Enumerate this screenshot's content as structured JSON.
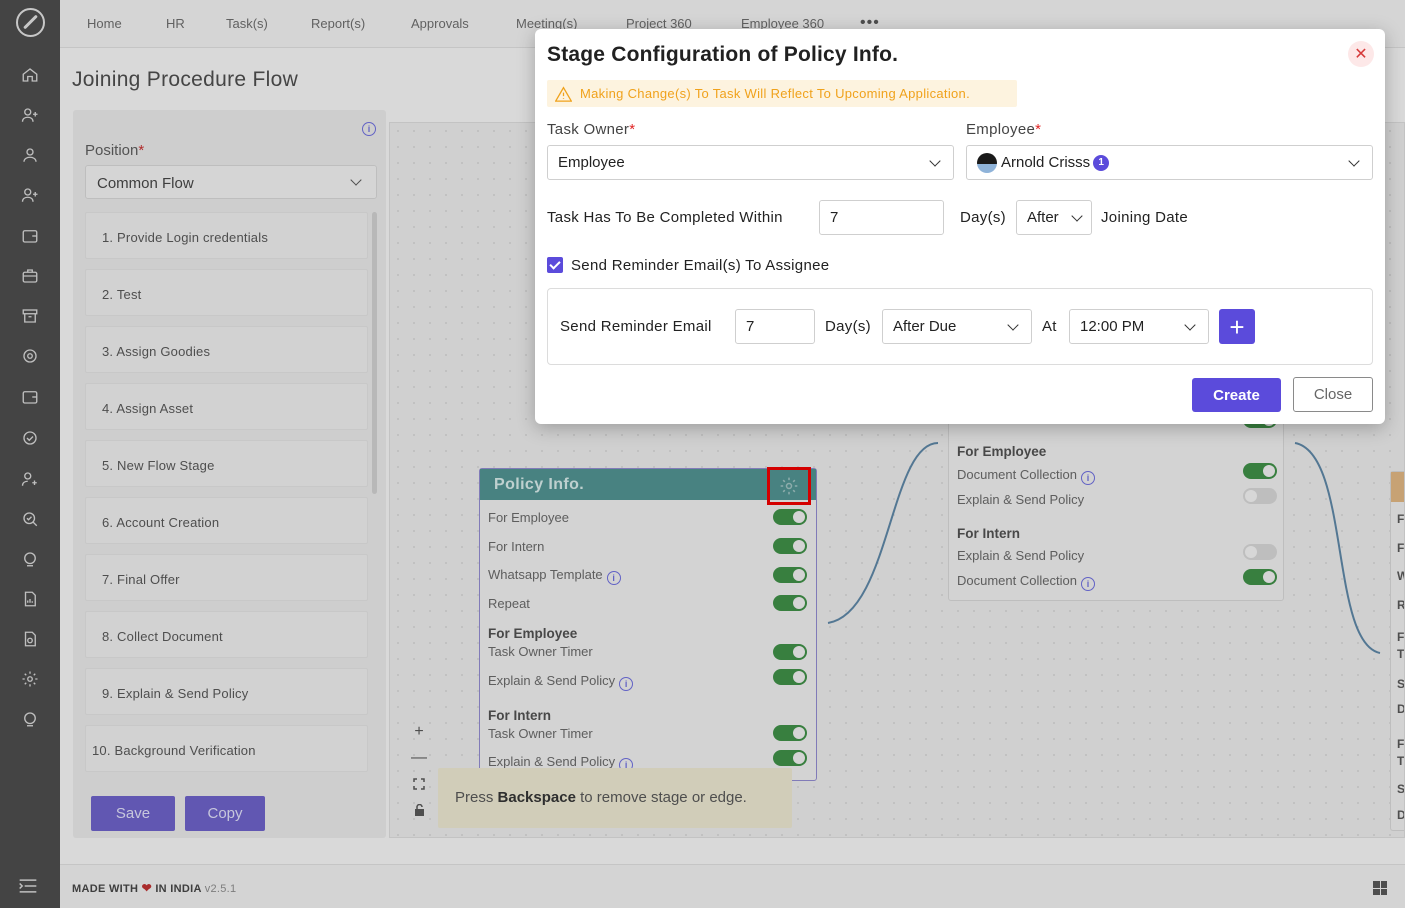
{
  "nav": {
    "items": [
      "Home",
      "HR",
      "Task(s)",
      "Report(s)",
      "Approvals",
      "Meeting(s)",
      "Project 360",
      "Employee 360"
    ],
    "more": "•••"
  },
  "page": {
    "title": "Joining Procedure Flow"
  },
  "left_panel": {
    "position_label": "Position",
    "required_mark": "*",
    "position_value": "Common Flow",
    "stages": [
      "1. Provide Login credentials",
      "2. Test",
      "3. Assign Goodies",
      "4. Assign Asset",
      "5. New Flow Stage",
      "6. Account Creation",
      "7. Final Offer",
      "8. Collect Document",
      "9. Explain & Send Policy",
      "10. Background Verification"
    ],
    "save_label": "Save",
    "copy_label": "Copy"
  },
  "canvas": {
    "zoom_in": "+",
    "zoom_out": "—",
    "hint_prefix": "Press ",
    "hint_key": "Backspace",
    "hint_suffix": " to remove stage or edge.",
    "policy_node": {
      "title": "Policy Info.",
      "rows": [
        "For Employee",
        "For Intern",
        "Whatsapp Template",
        "Repeat"
      ],
      "section_employee": "For Employee",
      "employee_rows": [
        "Task Owner Timer",
        "Explain & Send Policy"
      ],
      "section_intern": "For Intern",
      "intern_rows": [
        "Task Owner Timer",
        "Explain & Send Policy"
      ]
    },
    "right_node": {
      "section_employee": "For Employee",
      "employee_rows": [
        "Document Collection",
        "Explain & Send Policy"
      ],
      "section_intern": "For Intern",
      "intern_rows": [
        "Explain & Send Policy",
        "Document Collection"
      ]
    },
    "far_letters": [
      "F",
      "F",
      "W",
      "R",
      "F",
      "T",
      "S",
      "D",
      "F",
      "T",
      "S",
      "D"
    ]
  },
  "footer": {
    "made_with": "MADE WITH",
    "in_india": "IN INDIA",
    "version": "v2.5.1"
  },
  "modal": {
    "title": "Stage Configuration of Policy Info.",
    "warning": "Making Change(s) To Task Will Reflect To Upcoming Application.",
    "task_owner_label": "Task Owner",
    "task_owner_value": "Employee",
    "employee_label": "Employee",
    "employee_value": "Arnold Crisss",
    "employee_badge": "1",
    "within_label": "Task Has To Be Completed Within",
    "within_value": "7",
    "days_label": "Day(s)",
    "when_value": "After",
    "joining_label": "Joining Date",
    "reminder_checkbox_label": "Send Reminder Email(s) To Assignee",
    "reminder_label": "Send Reminder Email",
    "reminder_days_value": "7",
    "reminder_days_label": "Day(s)",
    "reminder_when_value": "After Due",
    "at_label": "At",
    "time_value": "12:00 PM",
    "add_label": "+",
    "create_label": "Create",
    "close_label": "Close",
    "close_x": "✕"
  }
}
